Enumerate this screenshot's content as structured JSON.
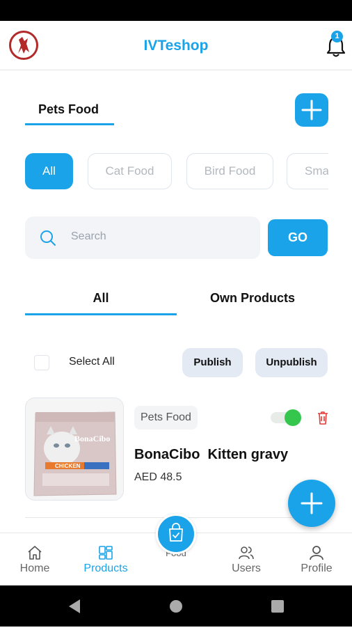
{
  "app": {
    "title": "IVTeshop",
    "notification_count": "1"
  },
  "category_tab": {
    "label": "Pets Food"
  },
  "filter_chips": [
    {
      "label": "All",
      "active": true
    },
    {
      "label": "Cat Food",
      "active": false
    },
    {
      "label": "Bird Food",
      "active": false
    },
    {
      "label": "Small Pets",
      "active": false
    }
  ],
  "search": {
    "placeholder": "Search",
    "value": "",
    "go_label": "GO"
  },
  "product_tabs": [
    {
      "label": "All",
      "active": true
    },
    {
      "label": "Own Products",
      "active": false
    }
  ],
  "bulk": {
    "select_all_label": "Select All",
    "publish_label": "Publish",
    "unpublish_label": "Unpublish"
  },
  "products": [
    {
      "category": "Pets Food",
      "name": "BonaCibo  Kitten gravy",
      "price": "AED 48.5",
      "published": true,
      "image": {
        "brand": "BonaCibo",
        "flavor": "CHICKEN"
      }
    }
  ],
  "bottom_nav": [
    {
      "label": "Home",
      "icon": "home-icon",
      "active": false
    },
    {
      "label": "Products",
      "icon": "products-icon",
      "active": true
    },
    {
      "label": "Food",
      "icon": "shopping-bag-icon",
      "active": false
    },
    {
      "label": "Users",
      "icon": "users-icon",
      "active": false
    },
    {
      "label": "Profile",
      "icon": "profile-icon",
      "active": false
    }
  ],
  "colors": {
    "accent": "#1aa3e8",
    "toggle_on": "#35c74d",
    "delete": "#e53935"
  }
}
